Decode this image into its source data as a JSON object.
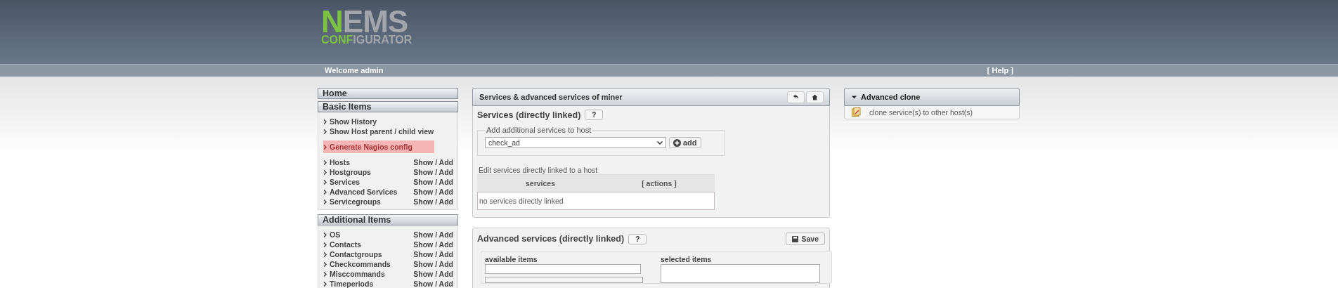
{
  "logo": {
    "first": "N",
    "rest": "EMS",
    "sub_green": "CONF",
    "sub_gray": "IGURATOR"
  },
  "nav": {
    "welcome": "Welcome admin",
    "help": "[ Help ]"
  },
  "sidebar": [
    {
      "title": "Home"
    },
    {
      "title": "Basic Items",
      "groups": [
        [
          {
            "label": "Show History",
            "selected": false
          },
          {
            "label": "Show Host parent / child view",
            "selected": false
          }
        ],
        [
          {
            "label": "Generate Nagios config",
            "selected": true
          }
        ],
        [
          {
            "label": "Hosts",
            "action": "Show / Add",
            "selected": false
          },
          {
            "label": "Hostgroups",
            "action": "Show / Add",
            "selected": false
          },
          {
            "label": "Services",
            "action": "Show / Add",
            "selected": false
          },
          {
            "label": "Advanced Services",
            "action": "Show / Add",
            "selected": false
          },
          {
            "label": "Servicegroups",
            "action": "Show / Add",
            "selected": false
          }
        ]
      ]
    },
    {
      "title": "Additional Items",
      "groups": [
        [
          {
            "label": "OS",
            "action": "Show / Add",
            "selected": false
          },
          {
            "label": "Contacts",
            "action": "Show / Add",
            "selected": false
          },
          {
            "label": "Contactgroups",
            "action": "Show / Add",
            "selected": false
          },
          {
            "label": "Checkcommands",
            "action": "Show / Add",
            "selected": false
          },
          {
            "label": "Misccommands",
            "action": "Show / Add",
            "selected": false
          },
          {
            "label": "Timeperiods",
            "action": "Show / Add",
            "selected": false
          }
        ]
      ]
    }
  ],
  "main": {
    "title": "Services & advanced services of miner",
    "services": {
      "title": "Services (directly linked)",
      "help": "?",
      "legend": "Add additional services to host",
      "select_value": "check_ad",
      "add_button": "add",
      "caption": "Edit services directly linked to a host",
      "columns": [
        "services",
        "[ actions ]"
      ],
      "empty": "no services directly linked"
    },
    "advanced": {
      "title": "Advanced services (directly linked)",
      "help": "?",
      "save_button": "Save",
      "available_label": "available items",
      "selected_label": "selected items"
    }
  },
  "right": {
    "title": "Advanced clone",
    "expanded": true,
    "items": [
      "clone service(s) to other host(s)"
    ]
  }
}
